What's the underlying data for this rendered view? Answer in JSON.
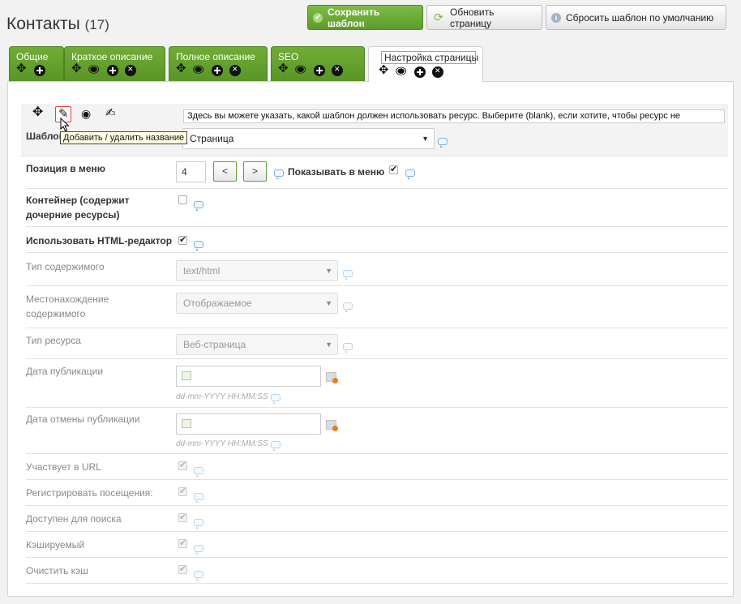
{
  "header": {
    "title": "Контакты",
    "count": "(17)"
  },
  "toolbar": {
    "save_label": "Сохранить шаблон",
    "refresh_label": "Обновить страницу",
    "reset_label": "Сбросить шаблон по умолчанию"
  },
  "tabs": [
    {
      "label": "Общие"
    },
    {
      "label": "Краткое описание"
    },
    {
      "label": "Полное описание"
    },
    {
      "label": "SEO"
    },
    {
      "label": "Настройка страницы"
    }
  ],
  "template_row": {
    "label": "Шаблон",
    "value": "Страница",
    "description": "Здесь вы можете указать, какой шаблон должен использовать ресурс. Выберите (blank), если хотите, чтобы ресурс не",
    "tooltip": "Добавить / удалить название"
  },
  "menu_position": {
    "label": "Позиция в меню",
    "value": "4",
    "prev": "<",
    "next": ">",
    "show_label": "Показывать в меню",
    "show_checked": true
  },
  "fields": {
    "container": {
      "label": "Контейнер (содержит дочерние ресурсы)",
      "checked": false
    },
    "richtext": {
      "label": "Использовать HTML-редактор",
      "checked": true
    },
    "content_type": {
      "label": "Тип содержимого",
      "value": "text/html"
    },
    "content_disposition": {
      "label": "Местонахождение содержимого",
      "value": "Отображаемое"
    },
    "class_key": {
      "label": "Тип ресурса",
      "value": "Веб-страница"
    },
    "pub_date": {
      "label": "Дата публикации",
      "hint": "dd-mm-YYYY HH:MM:SS"
    },
    "unpub_date": {
      "label": "Дата отмены публикации",
      "hint": "dd-mm-YYYY HH:MM:SS"
    },
    "alias_visible": {
      "label": "Участвует в URL",
      "checked": true
    },
    "hit_count": {
      "label": "Регистрировать посещения:",
      "checked": true
    },
    "searchable": {
      "label": "Доступен для поиска",
      "checked": true
    },
    "cacheable": {
      "label": "Кэшируемый",
      "checked": true
    },
    "clear_cache": {
      "label": "Очистить кэш",
      "checked": true
    }
  },
  "colors": {
    "tab_green": "#6fad35",
    "save_green": "#5c9c2a",
    "help_blue": "#7fb1dd"
  }
}
